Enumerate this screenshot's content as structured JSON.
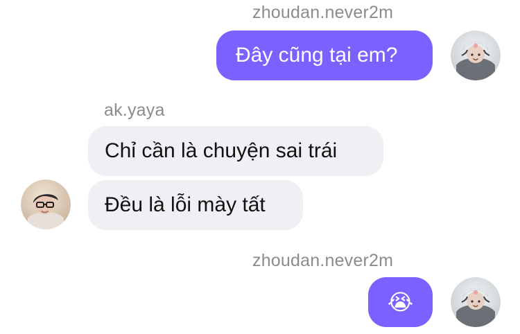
{
  "messages": [
    {
      "sender": "zhoudan.never2m",
      "text": "Đây cũng tại em?"
    },
    {
      "sender": "ak.yaya",
      "lines": [
        "Chỉ cần là chuyện sai trái",
        "Đều là lỗi mày tất"
      ]
    },
    {
      "sender": "zhoudan.never2m",
      "emoji": "😭"
    }
  ],
  "colors": {
    "me_bubble": "#7b61ff",
    "them_bubble": "#efeff4",
    "sender_text": "#8b8b90",
    "background": "#ffffff"
  },
  "avatars": {
    "me": "avatar-icon",
    "them": "avatar-icon"
  }
}
